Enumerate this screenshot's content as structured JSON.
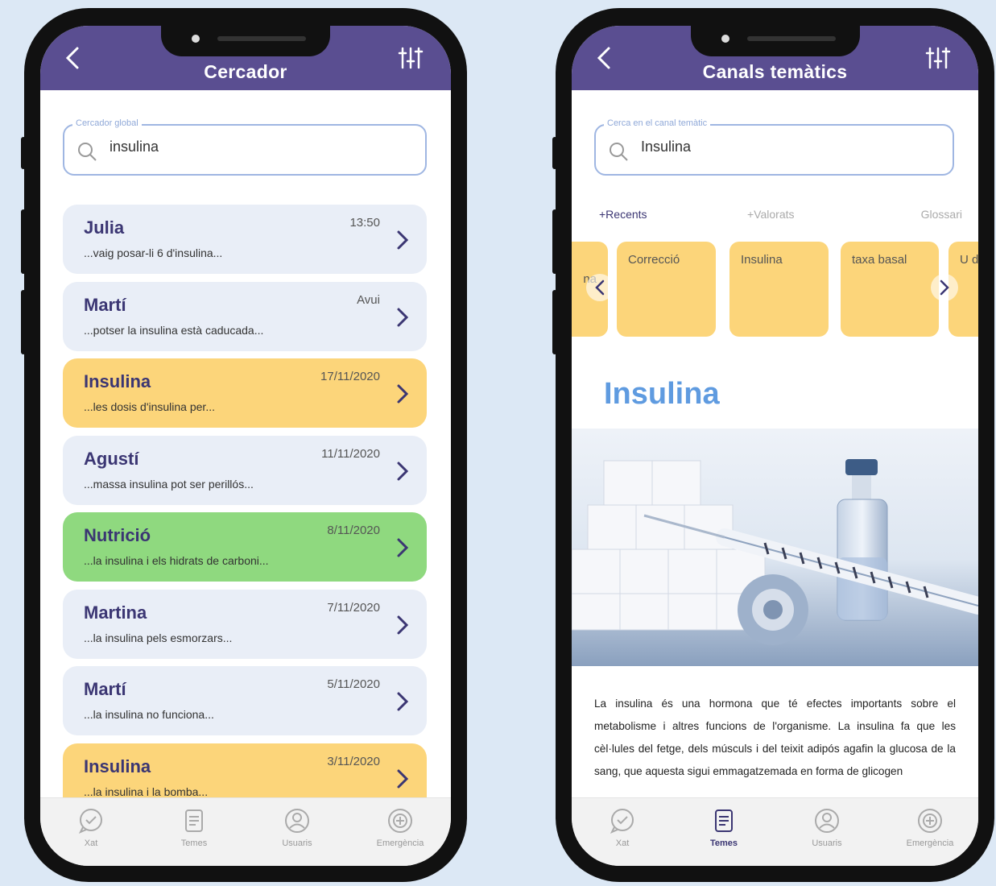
{
  "colors": {
    "header": "#5a4e91",
    "accent_blue": "#5f9be0",
    "yellow_item": "#fcd57a",
    "green_item": "#8fd97f",
    "plain_item": "#e9eef7",
    "name_text": "#3b3673"
  },
  "left": {
    "title": "Cercador",
    "search": {
      "label": "Cercador global",
      "value": "insulina"
    },
    "results": [
      {
        "name": "Julia",
        "snippet": "...vaig posar-li 6 d'insulina...",
        "date": "13:50",
        "style": "plain"
      },
      {
        "name": "Martí",
        "snippet": "...potser la insulina està caducada...",
        "date": "Avui",
        "style": "plain"
      },
      {
        "name": "Insulina",
        "snippet": "...les dosis d'insulina per...",
        "date": "17/11/2020",
        "style": "yellow"
      },
      {
        "name": "Agustí",
        "snippet": "...massa insulina pot ser perillós...",
        "date": "11/11/2020",
        "style": "plain"
      },
      {
        "name": "Nutrició",
        "snippet": "...la insulina i els hidrats de carboni...",
        "date": "8/11/2020",
        "style": "green"
      },
      {
        "name": "Martina",
        "snippet": "...la insulina pels esmorzars...",
        "date": "7/11/2020",
        "style": "plain"
      },
      {
        "name": "Martí",
        "snippet": "...la insulina no funciona...",
        "date": "5/11/2020",
        "style": "plain"
      },
      {
        "name": "Insulina",
        "snippet": "...la insulina i la bomba...",
        "date": "3/11/2020",
        "style": "yellow"
      }
    ],
    "tabs": [
      {
        "label": "Xat",
        "icon": "chat-icon",
        "active": false
      },
      {
        "label": "Temes",
        "icon": "document-icon",
        "active": false
      },
      {
        "label": "Usuaris",
        "icon": "user-icon",
        "active": false
      },
      {
        "label": "Emergència",
        "icon": "emergency-icon",
        "active": false
      }
    ]
  },
  "right": {
    "title": "Canals temàtics",
    "search": {
      "label": "Cerca en el canal temàtic",
      "value": "Insulina"
    },
    "filters": [
      "+Recents",
      "+Valorats",
      "Glossari"
    ],
    "cards": [
      {
        "text": "na",
        "partial": "left"
      },
      {
        "text": "Correcció"
      },
      {
        "text": "Insulina"
      },
      {
        "text": "taxa basal"
      },
      {
        "text": "U d",
        "partial": "right"
      }
    ],
    "article": {
      "heading": "Insulina",
      "body": "La insulina és una hormona que té efectes importants sobre el metabolisme i altres funcions de l'organisme. La insulina fa que les cèl·lules del fetge, dels músculs i del teixit adipós agafin la glucosa de la sang, que aquesta sigui emmagatzemada en forma de glicogen"
    },
    "tabs": [
      {
        "label": "Xat",
        "icon": "chat-icon",
        "active": false
      },
      {
        "label": "Temes",
        "icon": "document-icon",
        "active": true
      },
      {
        "label": "Usuaris",
        "icon": "user-icon",
        "active": false
      },
      {
        "label": "Emergència",
        "icon": "emergency-icon",
        "active": false
      }
    ]
  }
}
